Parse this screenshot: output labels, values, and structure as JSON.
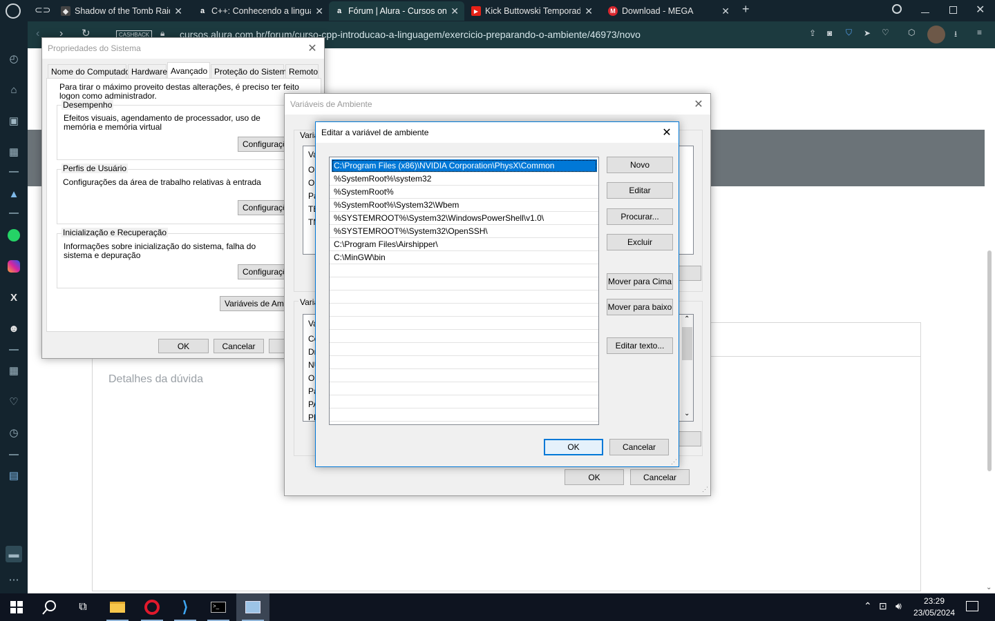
{
  "browser": {
    "tabs": [
      {
        "label": "Shadow of the Tomb Raide",
        "icon": "tomb-raider-icon"
      },
      {
        "label": "C++: Conhecendo a lingua",
        "icon": "alura-icon"
      },
      {
        "label": "Fórum | Alura - Cursos onli",
        "icon": "alura-icon"
      },
      {
        "label": "Kick Buttowski Temporada",
        "icon": "youtube-icon"
      },
      {
        "label": "Download - MEGA",
        "icon": "mega-icon"
      }
    ],
    "cashback_label": "CASHBACK",
    "url": "cursos.alura.com.br/forum/curso-cpp-introducao-a-linguagem/exercicio-preparando-o-ambiente/46973/novo"
  },
  "page": {
    "details_placeholder": "Detalhes da dúvida"
  },
  "system_properties": {
    "title": "Propriedades do Sistema",
    "tabs": [
      "Nome do Computador",
      "Hardware",
      "Avançado",
      "Proteção do Sistema",
      "Remoto"
    ],
    "admin_note": "Para tirar o máximo proveito destas alterações, é preciso ter feito logon como administrador.",
    "perf_label": "Desempenho",
    "perf_desc": "Efeitos visuais, agendamento de processador, uso de memória e memória virtual",
    "profiles_label": "Perfis de Usuário",
    "profiles_desc": "Configurações da área de trabalho relativas à entrada",
    "startup_label": "Inicialização e Recuperação",
    "startup_desc": "Informações sobre inicialização do sistema, falha do sistema e depuração",
    "settings_button": "Configurações...",
    "env_button": "Variáveis de Ambiente...",
    "ok": "OK",
    "cancel": "Cancelar"
  },
  "env_vars": {
    "title": "Variáveis de Ambiente",
    "user_group_label": "Variá",
    "system_group_label": "Variá",
    "list_header": "Va",
    "user_rows": [
      "On",
      "On",
      "Pa",
      "TE",
      "TM"
    ],
    "system_rows": [
      "Co",
      "Dr",
      "NU",
      "OS",
      "Pa",
      "PA",
      "PF"
    ],
    "ok": "OK",
    "cancel": "Cancelar"
  },
  "edit_var": {
    "title": "Editar a variável de ambiente",
    "entries": [
      "C:\\Program Files (x86)\\NVIDIA Corporation\\PhysX\\Common",
      "%SystemRoot%\\system32",
      "%SystemRoot%",
      "%SystemRoot%\\System32\\Wbem",
      "%SYSTEMROOT%\\System32\\WindowsPowerShell\\v1.0\\",
      "%SYSTEMROOT%\\System32\\OpenSSH\\",
      "C:\\Program Files\\Airshipper\\",
      "C:\\MinGW\\bin"
    ],
    "buttons": {
      "new": "Novo",
      "edit": "Editar",
      "browse": "Procurar...",
      "delete": "Excluir",
      "move_up": "Mover para Cima",
      "move_down": "Mover para baixo",
      "edit_text": "Editar texto..."
    },
    "ok": "OK",
    "cancel": "Cancelar"
  },
  "taskbar": {
    "time": "23:29",
    "date": "23/05/2024"
  },
  "colors": {
    "browser_dark": "#14242e",
    "browser_teal": "#1c3a3f",
    "accent_blue": "#0078d7"
  }
}
